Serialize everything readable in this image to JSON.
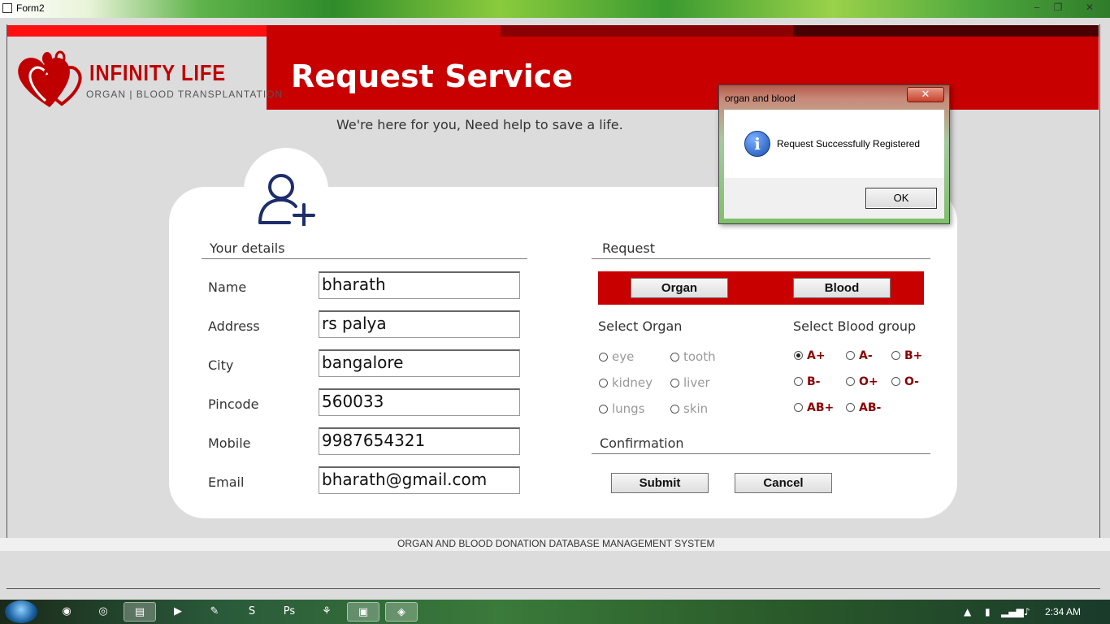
{
  "window": {
    "title": "Form2",
    "minimize_glyph": "‒",
    "maximize_glyph": "❐",
    "close_glyph": "✕"
  },
  "brand": {
    "name": "INFINITY LIFE",
    "subtitle": "ORGAN | BLOOD  TRANSPLANTATION",
    "accent_color": "#c80000"
  },
  "header": {
    "title": "Request Service"
  },
  "tagline": "We're here for you, Need help to save a life.",
  "details": {
    "heading": "Your details",
    "fields": [
      {
        "label": "Name",
        "value": "bharath"
      },
      {
        "label": "Address",
        "value": "rs palya"
      },
      {
        "label": "City",
        "value": "bangalore"
      },
      {
        "label": "Pincode",
        "value": "560033"
      },
      {
        "label": "Mobile",
        "value": "9987654321"
      },
      {
        "label": "Email",
        "value": "bharath@gmail.com"
      }
    ]
  },
  "request": {
    "heading": "Request",
    "organ_button": "Organ",
    "blood_button": "Blood",
    "organ_heading": "Select Organ",
    "organs": [
      "eye",
      "tooth",
      "kidney",
      "liver",
      "lungs",
      "skin"
    ],
    "blood_heading": "Select Blood group",
    "blood_groups": [
      "A+",
      "A-",
      "B+",
      "B-",
      "O+",
      "O-",
      "AB+",
      "AB-"
    ],
    "selected_blood_group": "A+"
  },
  "confirmation": {
    "heading": "Confirmation",
    "submit": "Submit",
    "cancel": "Cancel"
  },
  "footer": "ORGAN AND BLOOD DONATION DATABASE MANAGEMENT SYSTEM",
  "dialog": {
    "title": "organ and blood",
    "message": "Request Successfully Registered",
    "ok": "OK",
    "close_glyph": "✕",
    "info_glyph": "i"
  },
  "taskbar": {
    "clock": "2:34 AM",
    "items": [
      {
        "name": "firefox-icon",
        "glyph": "◉"
      },
      {
        "name": "chrome-icon",
        "glyph": "◎"
      },
      {
        "name": "explorer-icon",
        "glyph": "▤"
      },
      {
        "name": "media-player-icon",
        "glyph": "▶"
      },
      {
        "name": "notepad-icon",
        "glyph": "✎"
      },
      {
        "name": "sublime-icon",
        "glyph": "S"
      },
      {
        "name": "photoshop-icon",
        "glyph": "Ps"
      },
      {
        "name": "app-icon",
        "glyph": "⚘"
      },
      {
        "name": "form-app-icon",
        "glyph": "▣"
      },
      {
        "name": "vs-icon",
        "glyph": "◈"
      }
    ],
    "tray": {
      "show_hidden": "▲",
      "battery": "▮",
      "network": "▂▄▆",
      "volume": "♪"
    }
  }
}
